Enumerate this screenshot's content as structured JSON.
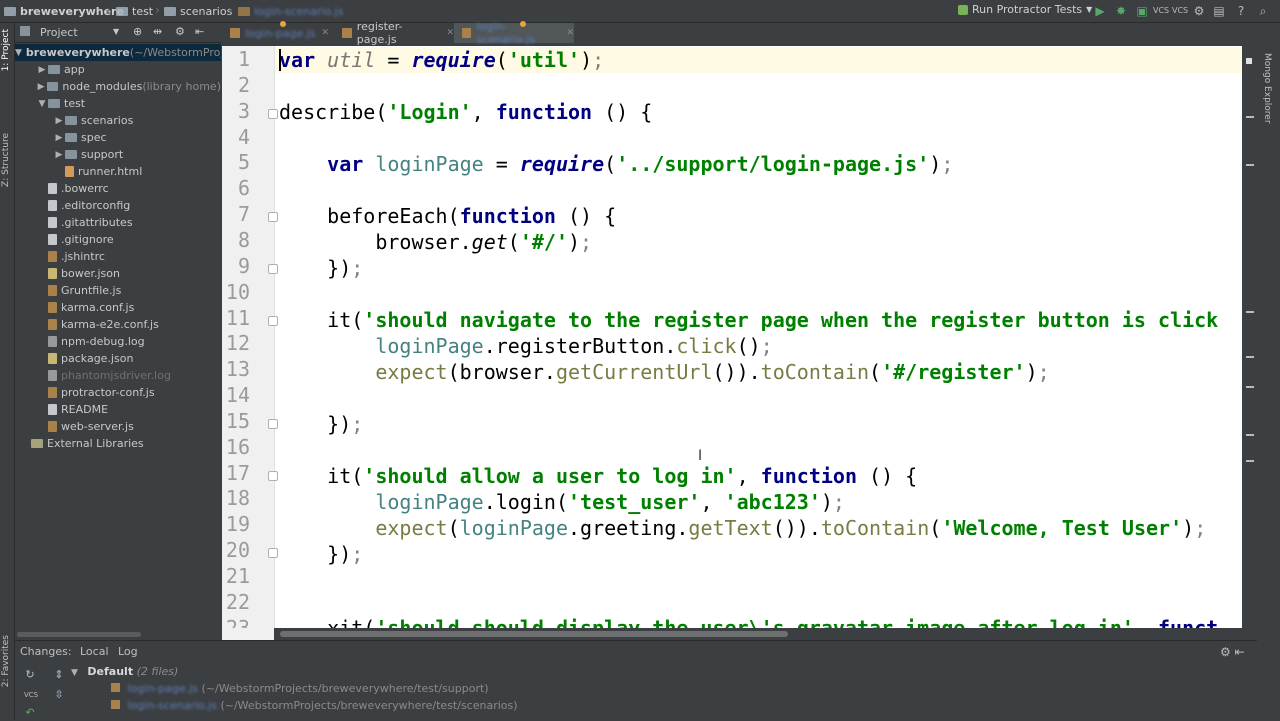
{
  "breadcrumbs": [
    "breweverywhere",
    "test",
    "scenarios",
    "login-scenario.js"
  ],
  "run_config": {
    "label": "Run Protractor Tests"
  },
  "tabs": [
    {
      "label": "login-page.js"
    },
    {
      "label": "register-page.js"
    },
    {
      "label": "login-scenario.js"
    }
  ],
  "left_strip": {
    "project": "1: Project",
    "structure": "Z: Structure",
    "favorites": "2: Favorites"
  },
  "right_strip": {
    "mongo": "Mongo Explorer"
  },
  "project_panel": {
    "title": "Project",
    "tree": [
      {
        "label": "breweverywhere",
        "suffix": " (~/WebstormProjects/breweverywhere)",
        "type": "root",
        "indent": 0,
        "arrow": "▼"
      },
      {
        "label": "app",
        "type": "folder",
        "indent": 1,
        "arrow": "▶"
      },
      {
        "label": "node_modules",
        "suffix": " (library home)",
        "type": "folder",
        "indent": 1,
        "arrow": "▶"
      },
      {
        "label": "test",
        "type": "folder",
        "indent": 1,
        "arrow": "▼"
      },
      {
        "label": "scenarios",
        "type": "folder",
        "indent": 2,
        "arrow": "▶"
      },
      {
        "label": "spec",
        "type": "folder",
        "indent": 2,
        "arrow": "▶"
      },
      {
        "label": "support",
        "type": "folder",
        "indent": 2,
        "arrow": "▶"
      },
      {
        "label": "runner.html",
        "type": "html",
        "indent": 2
      },
      {
        "label": ".bowerrc",
        "type": "file",
        "indent": 1
      },
      {
        "label": ".editorconfig",
        "type": "file",
        "indent": 1
      },
      {
        "label": ".gitattributes",
        "type": "file",
        "indent": 1
      },
      {
        "label": ".gitignore",
        "type": "file",
        "indent": 1
      },
      {
        "label": ".jshintrc",
        "type": "js",
        "indent": 1
      },
      {
        "label": "bower.json",
        "type": "json",
        "indent": 1
      },
      {
        "label": "Gruntfile.js",
        "type": "js",
        "indent": 1
      },
      {
        "label": "karma.conf.js",
        "type": "js",
        "indent": 1
      },
      {
        "label": "karma-e2e.conf.js",
        "type": "js",
        "indent": 1
      },
      {
        "label": "npm-debug.log",
        "type": "log",
        "indent": 1
      },
      {
        "label": "package.json",
        "type": "json",
        "indent": 1
      },
      {
        "label": "phantomjsdriver.log",
        "type": "log",
        "indent": 1,
        "muted": true
      },
      {
        "label": "protractor-conf.js",
        "type": "js",
        "indent": 1
      },
      {
        "label": "README",
        "type": "file",
        "indent": 1
      },
      {
        "label": "web-server.js",
        "type": "js",
        "indent": 1
      },
      {
        "label": "External Libraries",
        "type": "lib",
        "indent": 0
      }
    ]
  },
  "editor": {
    "line_numbers": [
      "1",
      "2",
      "3",
      "4",
      "5",
      "6",
      "7",
      "8",
      "9",
      "10",
      "11",
      "12",
      "13",
      "14",
      "15",
      "16",
      "17",
      "18",
      "19",
      "20",
      "21",
      "22",
      "23"
    ]
  },
  "changes_panel": {
    "tabs": [
      "Changes:",
      "Local",
      "Log"
    ],
    "group_label": "Default",
    "group_count": "(2 files)",
    "files": [
      {
        "name": "login-page.js",
        "path": "(~/WebstormProjects/breweverywhere/test/support)"
      },
      {
        "name": "login-scenario.js",
        "path": "(~/WebstormProjects/breweverywhere/test/scenarios)"
      }
    ]
  },
  "colors": {
    "keyword": "#000080",
    "string": "#008000",
    "current_line": "#fffae3",
    "selection": "#0d293e"
  }
}
